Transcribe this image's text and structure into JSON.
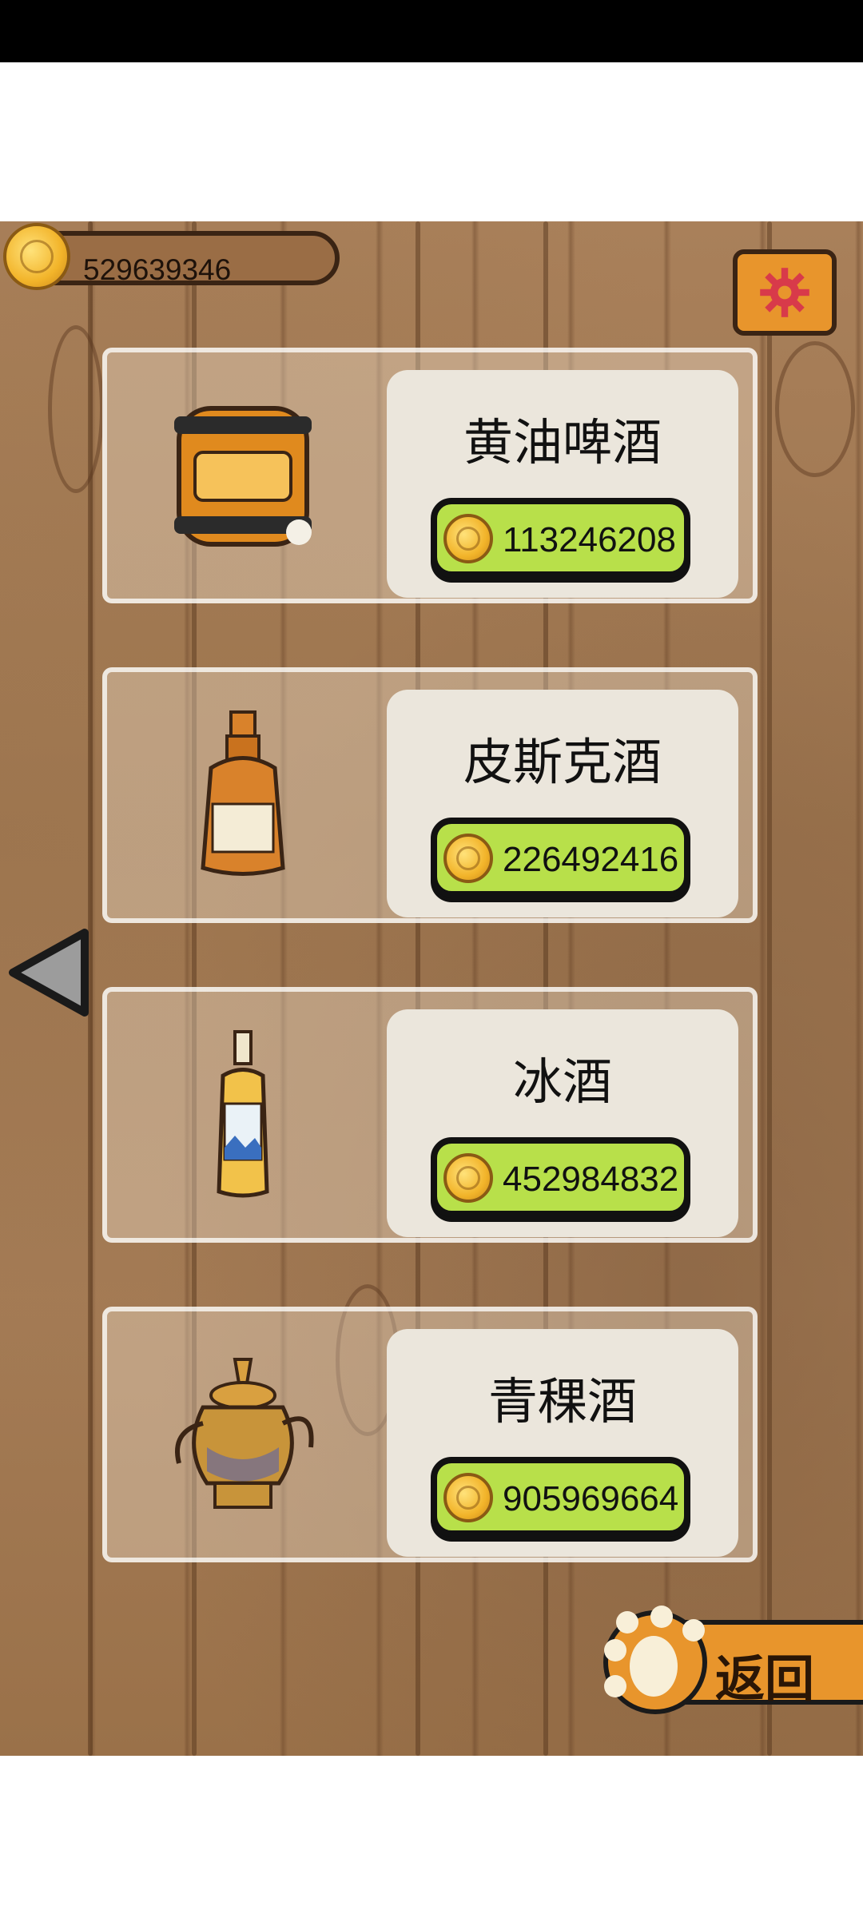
{
  "balance": "529639346",
  "items": [
    {
      "name": "黄油啤酒",
      "price": "113246208",
      "art": "butterbeer-barrel"
    },
    {
      "name": "皮斯克酒",
      "price": "226492416",
      "art": "pisco-bottle"
    },
    {
      "name": "冰酒",
      "price": "452984832",
      "art": "icewine-bottle"
    },
    {
      "name": "青稞酒",
      "price": "905969664",
      "art": "highland-barley-teapot"
    }
  ],
  "back_label": "返回",
  "colors": {
    "accent": "#b8e04a",
    "settings_bg": "#e8952c",
    "wood": "#a47b55"
  },
  "icons": {
    "settings": "gear-icon",
    "nav_prev": "left-arrow-icon",
    "back": "paw-icon",
    "currency": "coin-icon"
  }
}
